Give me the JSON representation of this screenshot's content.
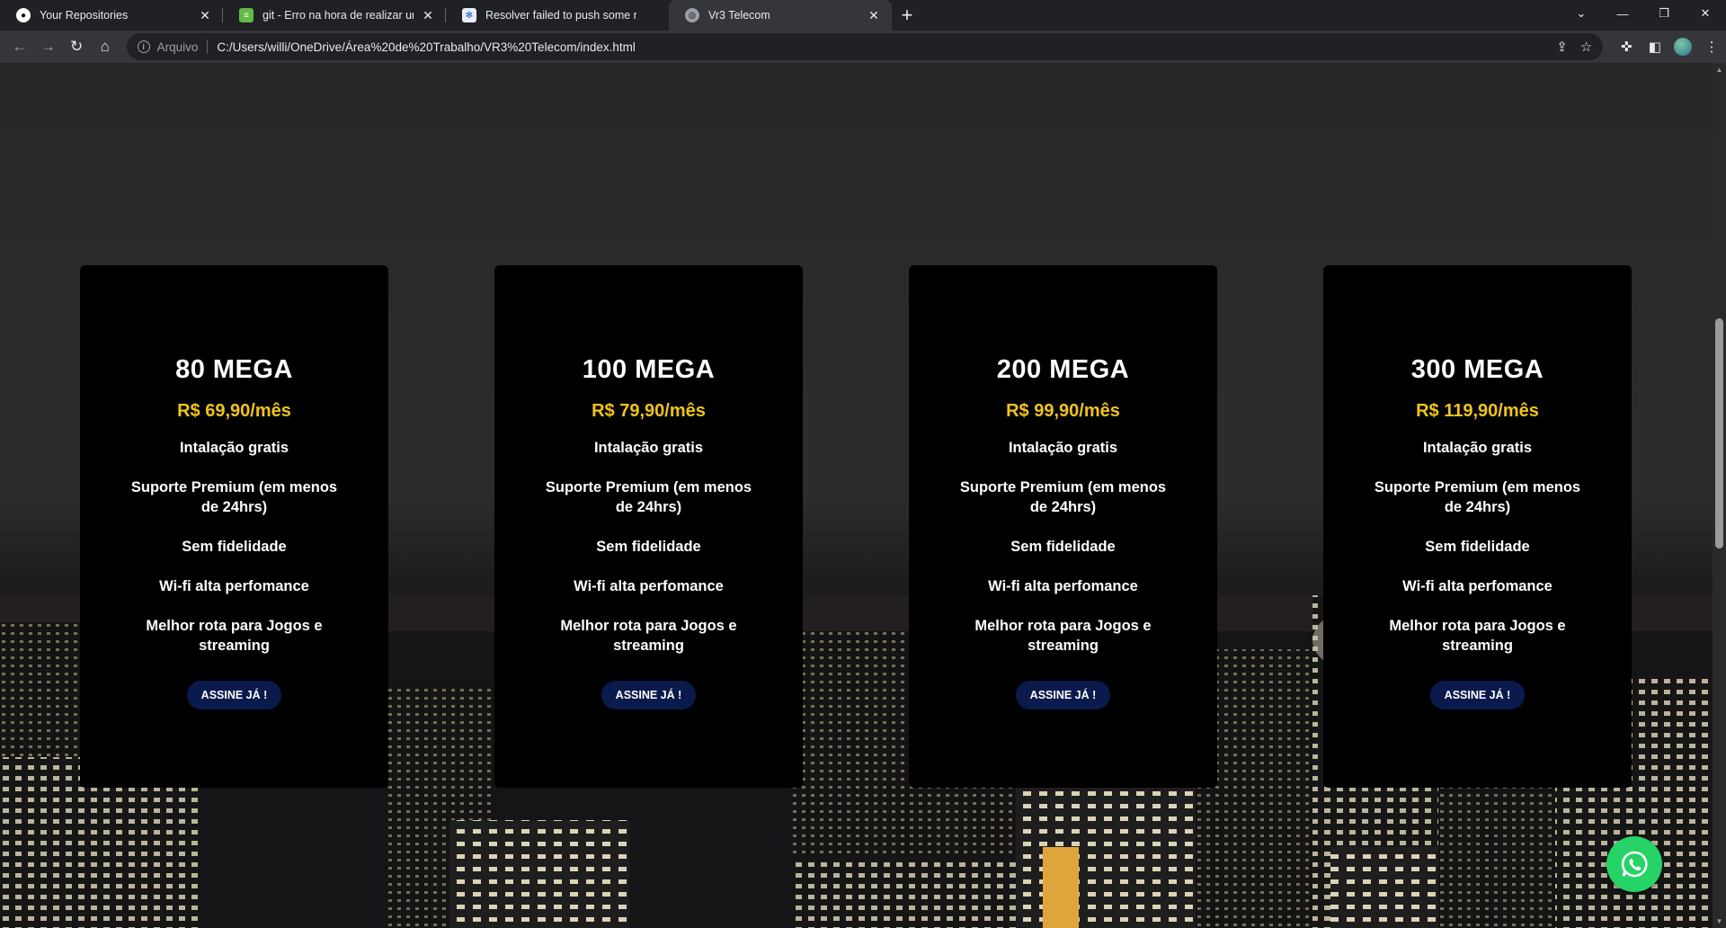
{
  "browser": {
    "tabs": [
      {
        "title": "Your Repositories",
        "icon": "github-icon",
        "active": false
      },
      {
        "title": "git - Erro na hora de realizar um",
        "icon": "stackoverflow-icon",
        "active": false
      },
      {
        "title": "Resolver failed to push some refs",
        "icon": "site-icon",
        "active": false
      },
      {
        "title": "Vr3 Telecom",
        "icon": "globe-icon",
        "active": true
      }
    ],
    "address": {
      "scheme_label": "Arquivo",
      "url": "C:/Users/willi/OneDrive/Área%20de%20Trabalho/VR3%20Telecom/index.html"
    }
  },
  "plans": [
    {
      "name": "80 MEGA",
      "price": "R$ 69,90/mês",
      "features": [
        "Intalação gratis",
        "Suporte Premium (em menos de 24hrs)",
        "Sem fidelidade",
        "Wi-fi alta perfomance",
        "Melhor rota para Jogos e streaming"
      ],
      "cta": "ASSINE JÁ !"
    },
    {
      "name": "100 MEGA",
      "price": "R$ 79,90/mês",
      "features": [
        "Intalação gratis",
        "Suporte Premium (em menos de 24hrs)",
        "Sem fidelidade",
        "Wi-fi alta perfomance",
        "Melhor rota para Jogos e streaming"
      ],
      "cta": "ASSINE JÁ !"
    },
    {
      "name": "200 MEGA",
      "price": "R$ 99,90/mês",
      "features": [
        "Intalação gratis",
        "Suporte Premium (em menos de 24hrs)",
        "Sem fidelidade",
        "Wi-fi alta perfomance",
        "Melhor rota para Jogos e streaming"
      ],
      "cta": "ASSINE JÁ !"
    },
    {
      "name": "300 MEGA",
      "price": "R$ 119,90/mês",
      "features": [
        "Intalação gratis",
        "Suporte Premium (em menos de 24hrs)",
        "Sem fidelidade",
        "Wi-fi alta perfomance",
        "Melhor rota para Jogos e streaming"
      ],
      "cta": "ASSINE JÁ !"
    }
  ],
  "colors": {
    "price": "#f0c419",
    "cta_bg": "#0b1a4d",
    "card_bg": "#000000",
    "whatsapp": "#25d366"
  },
  "floating": {
    "icon": "whatsapp-icon"
  }
}
